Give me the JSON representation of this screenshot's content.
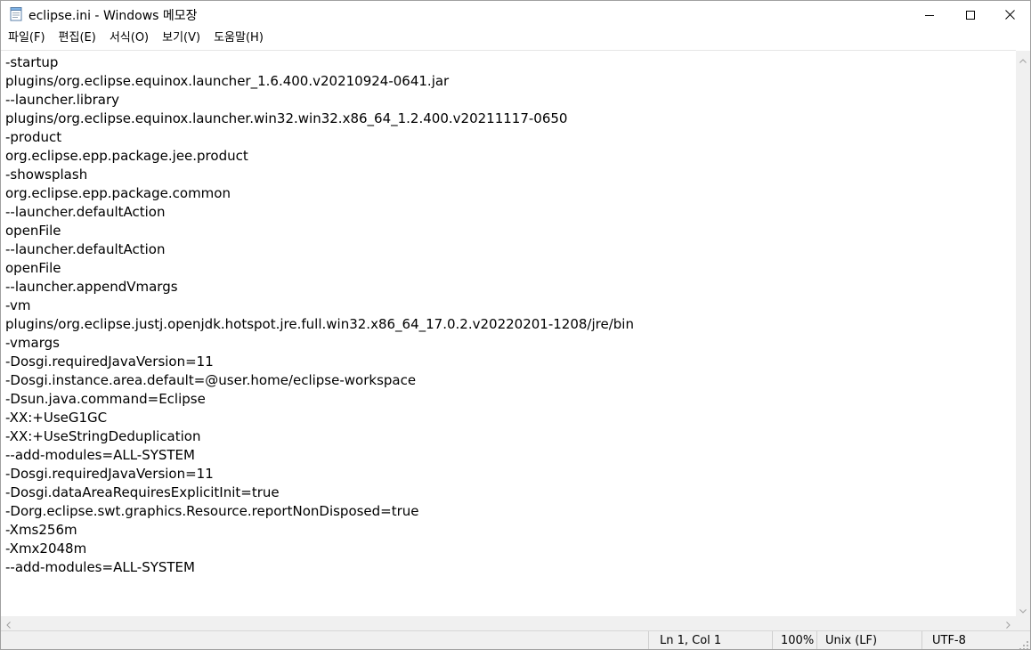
{
  "window": {
    "title": "eclipse.ini - Windows 메모장"
  },
  "menu": [
    {
      "label": "파일(F)"
    },
    {
      "label": "편집(E)"
    },
    {
      "label": "서식(O)"
    },
    {
      "label": "보기(V)"
    },
    {
      "label": "도움말(H)"
    }
  ],
  "editor": {
    "lines": [
      "-startup",
      "plugins/org.eclipse.equinox.launcher_1.6.400.v20210924-0641.jar",
      "--launcher.library",
      "plugins/org.eclipse.equinox.launcher.win32.win32.x86_64_1.2.400.v20211117-0650",
      "-product",
      "org.eclipse.epp.package.jee.product",
      "-showsplash",
      "org.eclipse.epp.package.common",
      "--launcher.defaultAction",
      "openFile",
      "--launcher.defaultAction",
      "openFile",
      "--launcher.appendVmargs",
      "-vm",
      "plugins/org.eclipse.justj.openjdk.hotspot.jre.full.win32.x86_64_17.0.2.v20220201-1208/jre/bin",
      "-vmargs",
      "-Dosgi.requiredJavaVersion=11",
      "-Dosgi.instance.area.default=@user.home/eclipse-workspace",
      "-Dsun.java.command=Eclipse",
      "-XX:+UseG1GC",
      "-XX:+UseStringDeduplication",
      "--add-modules=ALL-SYSTEM",
      "-Dosgi.requiredJavaVersion=11",
      "-Dosgi.dataAreaRequiresExplicitInit=true",
      "-Dorg.eclipse.swt.graphics.Resource.reportNonDisposed=true",
      "-Xms256m",
      "-Xmx2048m",
      "--add-modules=ALL-SYSTEM"
    ]
  },
  "status": {
    "position": "Ln 1, Col 1",
    "zoom": "100%",
    "line_ending": "Unix (LF)",
    "encoding": "UTF-8"
  },
  "icons": {
    "app": "notepad-icon",
    "minimize": "minimize-icon",
    "maximize": "maximize-icon",
    "close": "close-icon",
    "scroll_up": "chevron-up-icon",
    "scroll_down": "chevron-down-icon",
    "scroll_left": "chevron-left-icon",
    "scroll_right": "chevron-right-icon",
    "resize": "resize-grip-icon"
  },
  "colors": {
    "background": "#ffffff",
    "chrome": "#f0f0f0",
    "text": "#000000"
  }
}
